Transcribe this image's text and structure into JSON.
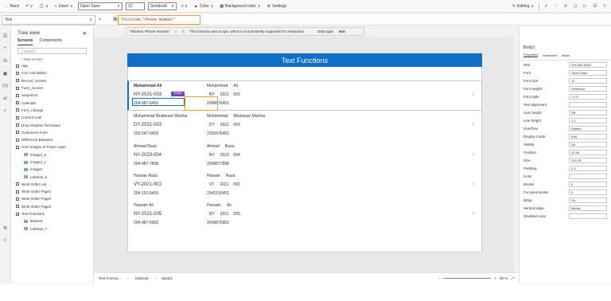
{
  "toolbar": {
    "back": "Back",
    "insert": "Insert",
    "font": "Open Sans",
    "font_size": "12",
    "font_weight": "Semibold",
    "color": "Color",
    "background_color": "Background color",
    "settings": "Settings",
    "editing": "Editing"
  },
  "formula_bar": {
    "property": "Text",
    "fx": "fx",
    "formula": "ThisItem.'Phone Number'"
  },
  "hint": {
    "expression": "ThisItem.'Phone Number'",
    "equals": "=",
    "message": "This formula uses scope, which is not presently supported for evaluation.",
    "data_type_label": "Data type:",
    "data_type": "text"
  },
  "tree": {
    "title": "Tree view",
    "tabs": [
      "Screens",
      "Components"
    ],
    "search_placeholder": "Search",
    "new_screen": "+ New screen",
    "items": [
      {
        "label": "App",
        "indent": 0
      },
      {
        "label": "Icon And Button",
        "indent": 0
      },
      {
        "label": "Record_Screen",
        "indent": 0
      },
      {
        "label": "Form_Screen",
        "indent": 0
      },
      {
        "label": "Sequence",
        "indent": 0
      },
      {
        "label": "Calendar",
        "indent": 0
      },
      {
        "label": "Font_Change",
        "indent": 0
      },
      {
        "label": "Current User",
        "indent": 0
      },
      {
        "label": "Drop Shadow Technique",
        "indent": 0
      },
      {
        "label": "Customize Form",
        "indent": 0
      },
      {
        "label": "Difference Between",
        "indent": 0
      },
      {
        "label": "SVG Images in Power Apps",
        "indent": 0
      },
      {
        "label": "Image4_2",
        "indent": 1
      },
      {
        "label": "Image4_1",
        "indent": 1
      },
      {
        "label": "Image4",
        "indent": 1
      },
      {
        "label": "Label16_6",
        "indent": 1
      },
      {
        "label": "Work Order List",
        "indent": 0
      },
      {
        "label": "Work Order Page1",
        "indent": 0
      },
      {
        "label": "Work Order Page2",
        "indent": 0
      },
      {
        "label": "Work Order Page3",
        "indent": 0
      },
      {
        "label": "Text Functions",
        "indent": 0
      },
      {
        "label": "Button4",
        "indent": 1
      },
      {
        "label": "Label16_7",
        "indent": 1
      }
    ]
  },
  "screen": {
    "title": "Text Functions"
  },
  "gallery": [
    {
      "name": "Muhammad Ali",
      "id": "NY-2021-003",
      "phone": "204-987-6453",
      "first": "Muhammad",
      "last": "Ali",
      "state": "NY",
      "year": "2021",
      "num": "003",
      "digits": "2049876453"
    },
    {
      "name": "Muhammad Mudassar Mazhar",
      "id": "DY-2021-003",
      "phone": "233-547-6453",
      "first": "Muhammad",
      "last": "Mudassar Mazhar",
      "state": "DY",
      "year": "2021",
      "num": "003",
      "digits": "2335476453"
    },
    {
      "name": "Ahmad Raza",
      "id": "NY-2023-004",
      "phone": "204-987-7898",
      "first": "Ahmad",
      "last": "Raza",
      "state": "NY",
      "year": "2023",
      "num": "004",
      "digits": "2049877898"
    },
    {
      "name": "Hassan Raza",
      "id": "VY-2021-003",
      "phone": "204-151-6453",
      "first": "Hassan",
      "last": "Raza",
      "state": "VY",
      "year": "2021",
      "num": "003",
      "digits": "2041516453"
    },
    {
      "name": "Hussain Ali",
      "id": "NY-2021-005",
      "phone": "204-987-6953",
      "first": "Hussain",
      "last": "Ali",
      "state": "NY",
      "year": "2021",
      "num": "005",
      "digits": "2049876953"
    }
  ],
  "selection_tag": "Body3",
  "properties": {
    "header": "Body3",
    "tabs": [
      "Properties",
      "Advanced",
      "Ideas"
    ],
    "rows": [
      {
        "label": "Text",
        "value": "204-987-6453"
      },
      {
        "label": "Font",
        "value": "Open Sans"
      },
      {
        "label": "Font size",
        "value": "12"
      },
      {
        "label": "Font weight",
        "value": "Semibold"
      },
      {
        "label": "Font style",
        "value": "/   U   S"
      },
      {
        "label": "Text alignment",
        "value": ""
      },
      {
        "label": "Auto height",
        "value": "Off"
      },
      {
        "label": "Line height",
        "value": "1.2"
      },
      {
        "label": "Overflow",
        "value": "Hidden"
      },
      {
        "label": "Display mode",
        "value": "Edit"
      },
      {
        "label": "Visible",
        "value": "On"
      },
      {
        "label": "Position",
        "value": "20   48"
      },
      {
        "label": "Size",
        "value": "200   35"
      },
      {
        "label": "Padding",
        "value": "0   0"
      },
      {
        "label": "Color",
        "value": ""
      },
      {
        "label": "Border",
        "value": "0"
      },
      {
        "label": "Focused border",
        "value": "0"
      },
      {
        "label": "Wrap",
        "value": "On"
      },
      {
        "label": "Vertical align",
        "value": "Middle"
      },
      {
        "label": "Disabled color",
        "value": ""
      }
    ]
  },
  "statusbar": {
    "crumbs": [
      "Text Functio...",
      "Gallery6",
      "Body3"
    ],
    "zoom": "60 %"
  },
  "colors": {
    "accent": "#0f6fc6",
    "highlight": "#f0a030",
    "purple": "#7b44ab"
  }
}
